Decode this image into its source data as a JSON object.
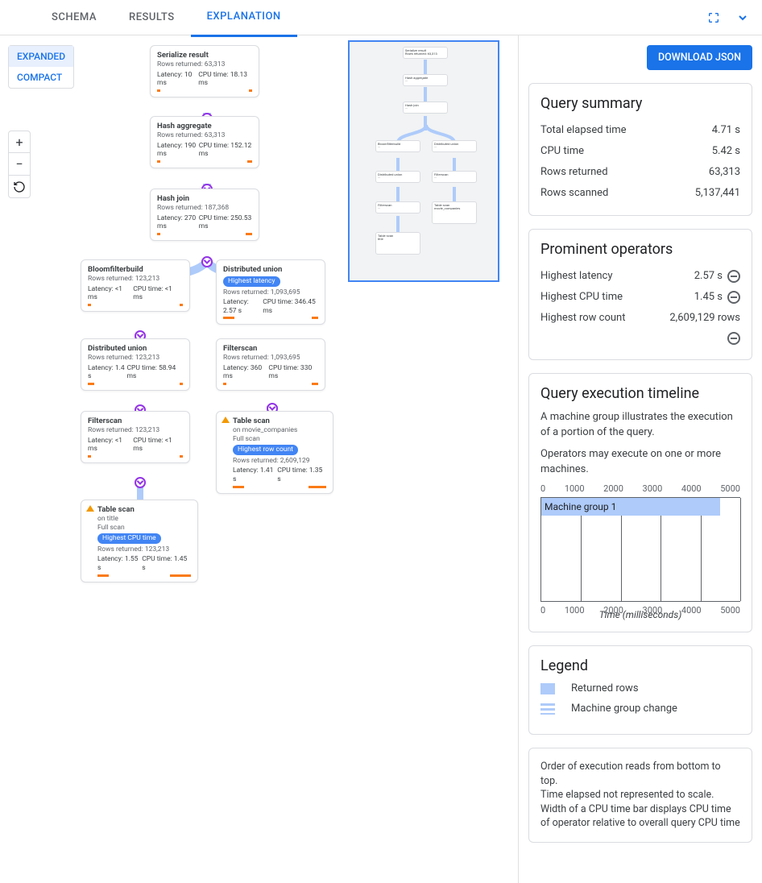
{
  "tabs": {
    "schema": "SCHEMA",
    "results": "RESULTS",
    "explanation": "EXPLANATION"
  },
  "viewToggle": {
    "expanded": "EXPANDED",
    "compact": "COMPACT"
  },
  "download": "DOWNLOAD JSON",
  "summary": {
    "title": "Query summary",
    "total_elapsed_k": "Total elapsed time",
    "total_elapsed_v": "4.71 s",
    "cpu_time_k": "CPU time",
    "cpu_time_v": "5.42 s",
    "rows_returned_k": "Rows returned",
    "rows_returned_v": "63,313",
    "rows_scanned_k": "Rows scanned",
    "rows_scanned_v": "5,137,441"
  },
  "prominent": {
    "title": "Prominent operators",
    "hl_k": "Highest latency",
    "hl_v": "2.57 s",
    "hc_k": "Highest CPU time",
    "hc_v": "1.45 s",
    "hr_k": "Highest row count",
    "hr_v": "2,609,129 rows"
  },
  "timeline": {
    "title": "Query execution timeline",
    "desc1": "A machine group illustrates the execution of a portion of the query.",
    "desc2": "Operators may execute on one or more machines.",
    "ticks": [
      "0",
      "1000",
      "2000",
      "3000",
      "4000",
      "5000"
    ],
    "bar_label": "Machine group 1",
    "xlabel": "Time (milliseconds)"
  },
  "legend": {
    "title": "Legend",
    "returned": "Returned rows",
    "mg_change": "Machine group change"
  },
  "footer": {
    "l1": "Order of execution reads from bottom to top.",
    "l2": "Time elapsed not represented to scale.",
    "l3": "Width of a CPU time bar displays CPU time of operator relative to overall query CPU time"
  },
  "nodes": {
    "serialize": {
      "title": "Serialize result",
      "rows": "Rows returned: 63,313",
      "lat": "Latency: 10 ms",
      "cpu": "CPU time: 18.13 ms"
    },
    "hashagg": {
      "title": "Hash aggregate",
      "rows": "Rows returned: 63,313",
      "lat": "Latency: 190 ms",
      "cpu": "CPU time: 152.12 ms"
    },
    "hashjoin": {
      "title": "Hash join",
      "rows": "Rows returned: 187,368",
      "lat": "Latency: 270 ms",
      "cpu": "CPU time: 250.53 ms"
    },
    "bloom": {
      "title": "Bloomfilterbuild",
      "rows": "Rows returned: 123,213",
      "lat": "Latency: <1 ms",
      "cpu": "CPU time: <1 ms"
    },
    "du1": {
      "title": "Distributed union",
      "tag": "Highest latency",
      "rows": "Rows returned: 1,093,695",
      "lat": "Latency: 2.57 s",
      "cpu": "CPU time: 346.45 ms"
    },
    "du2": {
      "title": "Distributed union",
      "rows": "Rows returned: 123,213",
      "lat": "Latency: 1.4 s",
      "cpu": "CPU time: 58.94 ms"
    },
    "fs1": {
      "title": "Filterscan",
      "rows": "Rows returned: 1,093,695",
      "lat": "Latency: 360 ms",
      "cpu": "CPU time: 330 ms"
    },
    "fs2": {
      "title": "Filterscan",
      "rows": "Rows returned: 123,213",
      "lat": "Latency: <1 ms",
      "cpu": "CPU time: <1 ms"
    },
    "ts_mc": {
      "title": "Table scan",
      "on": "on movie_companies",
      "fs": "Full scan",
      "tag": "Highest row count",
      "rows": "Rows returned: 2,609,129",
      "lat": "Latency: 1.41 s",
      "cpu": "CPU time: 1.35 s"
    },
    "ts_title": {
      "title": "Table scan",
      "on": "on title",
      "fs": "Full scan",
      "tag": "Highest CPU time",
      "rows": "Rows returned: 123,213",
      "lat": "Latency: 1.55 s",
      "cpu": "CPU time: 1.45 s"
    }
  }
}
